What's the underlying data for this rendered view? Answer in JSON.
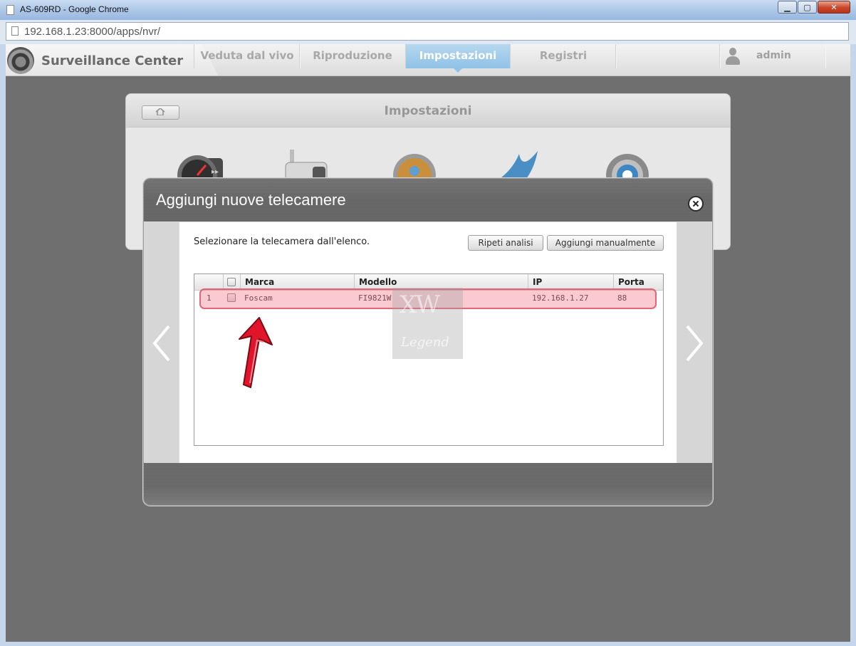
{
  "window": {
    "title": "AS-609RD - Google Chrome",
    "url": "192.168.1.23:8000/apps/nvr/",
    "minimize_glyph": "▁",
    "maximize_glyph": "▢",
    "close_glyph": "✕"
  },
  "appnav": {
    "brand": "Surveillance Center",
    "tabs": [
      {
        "label": "Veduta dal vivo",
        "active": false
      },
      {
        "label": "Riproduzione",
        "active": false
      },
      {
        "label": "Impostazioni",
        "active": true
      },
      {
        "label": "Registri",
        "active": false
      }
    ],
    "user": "admin"
  },
  "settings": {
    "title": "Impostazioni",
    "icons": [
      "speedometer-icon",
      "camera-icon",
      "user-star-icon",
      "bird-icon",
      "gear-icon"
    ]
  },
  "modal": {
    "title": "Aggiungi nuove telecamere",
    "instruction": "Selezionare la telecamera dall'elenco.",
    "buttons": {
      "rescan": "Ripeti analisi",
      "add_manual": "Aggiungi manualmente"
    },
    "table": {
      "columns": [
        "Marca",
        "Modello",
        "IP",
        "Porta"
      ],
      "rows": [
        {
          "index": "1",
          "brand": "Foscam",
          "model": "FI9821W",
          "ip": "192.168.1.27",
          "port": "88"
        }
      ]
    }
  },
  "watermark": {
    "top": "XW",
    "bottom": "Legend"
  },
  "colors": {
    "accent_tab": "#8fc2e6",
    "highlight": "#e2526a",
    "annotation_arrow": "#e0142a"
  }
}
